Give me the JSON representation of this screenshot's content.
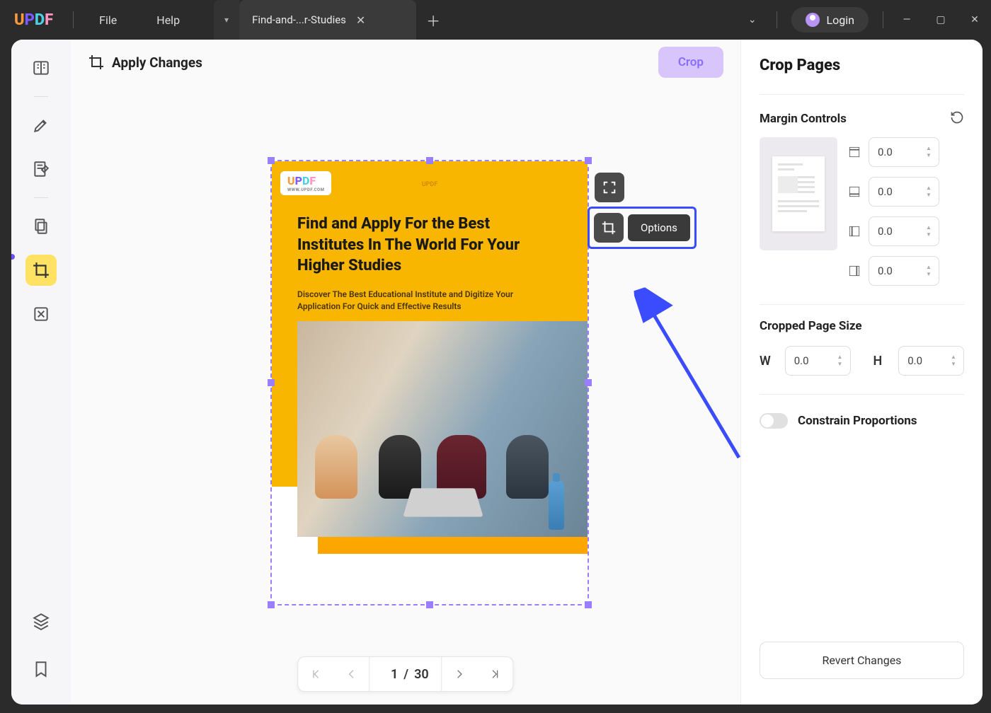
{
  "titlebar": {
    "logo_letters": [
      "U",
      "P",
      "D",
      "F"
    ],
    "menu": {
      "file": "File",
      "help": "Help"
    },
    "tab": {
      "title": "Find-and-...r-Studies"
    },
    "login": "Login"
  },
  "canvas": {
    "apply_label": "Apply Changes",
    "crop_btn": "Crop",
    "options_tip": "Options",
    "pager": {
      "current": "1",
      "sep": "/",
      "total": "30"
    }
  },
  "document": {
    "brand": "UPDF",
    "badge_sub": "WWW.UPDF.COM",
    "heading": "Find and Apply For the Best Institutes In The World For Your Higher Studies",
    "sub": "Discover The Best Educational Institute and Digitize Your Application For Quick and Effective Results"
  },
  "panel": {
    "title": "Crop Pages",
    "margin_title": "Margin Controls",
    "margins": {
      "top": "0.0",
      "bottom": "0.0",
      "left": "0.0",
      "right": "0.0"
    },
    "size_title": "Cropped Page Size",
    "w_label": "W",
    "h_label": "H",
    "size": {
      "w": "0.0",
      "h": "0.0"
    },
    "constrain": "Constrain Proportions",
    "revert": "Revert Changes"
  }
}
